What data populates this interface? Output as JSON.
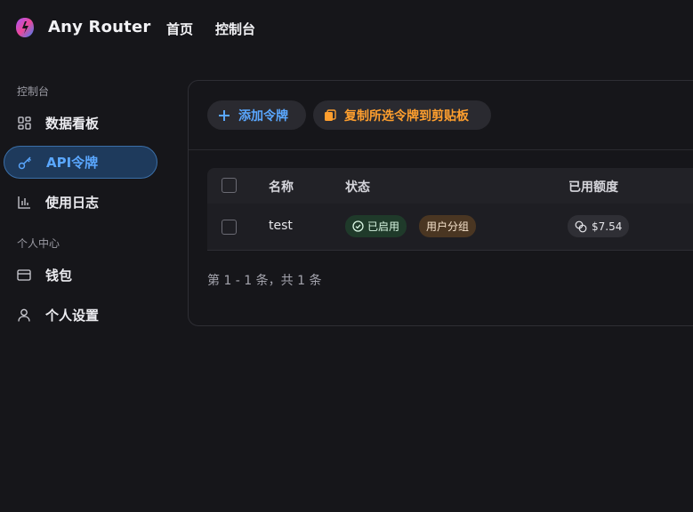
{
  "header": {
    "brand": "Any Router",
    "nav": {
      "home": "首页",
      "console": "控制台"
    }
  },
  "sidebar": {
    "section_console": "控制台",
    "section_personal": "个人中心",
    "items": {
      "dashboard": "数据看板",
      "api_tokens": "API令牌",
      "usage_logs": "使用日志",
      "wallet": "钱包",
      "settings": "个人设置"
    }
  },
  "toolbar": {
    "add_token": "添加令牌",
    "copy_selected": "复制所选令牌到剪贴板"
  },
  "table": {
    "columns": [
      "名称",
      "状态",
      "已用额度"
    ],
    "rows": [
      {
        "name": "test",
        "status": "已启用",
        "group": "用户分组",
        "used_quota": "$7.54"
      }
    ]
  },
  "pagination": {
    "summary": "第 1 - 1 条，共 1 条"
  },
  "colors": {
    "accent_blue": "#5aa7ff",
    "accent_orange": "#ff9f2e",
    "background": "#16161a"
  },
  "icons": {
    "logo": "any-router-logo",
    "dashboard": "grid-icon",
    "api_tokens": "key-icon",
    "usage_logs": "bar-chart-icon",
    "wallet": "card-icon",
    "settings": "user-icon",
    "add": "plus-icon",
    "copy": "copy-icon",
    "enabled": "check-circle-icon",
    "quota": "coins-icon"
  }
}
